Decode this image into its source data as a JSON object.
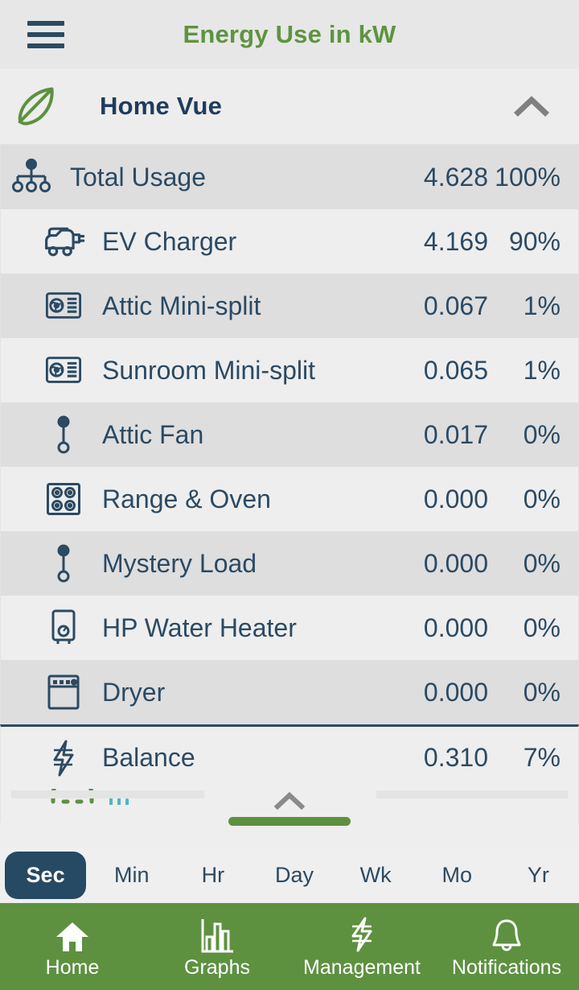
{
  "header": {
    "menu_icon": "hamburger-menu-icon",
    "title": "Energy Use in kW",
    "title_color": "#5e9440"
  },
  "device": {
    "leaf_icon": "leaf-icon",
    "name": "Home Vue",
    "collapse_icon": "chevron-up-icon"
  },
  "list": {
    "rows": [
      {
        "icon": "network-tree-icon",
        "label": "Total Usage",
        "value": "4.628",
        "percent": "100%"
      },
      {
        "icon": "ev-charger-icon",
        "label": "EV Charger",
        "value": "4.169",
        "percent": "90%"
      },
      {
        "icon": "mini-split-icon",
        "label": "Attic Mini-split",
        "value": "0.067",
        "percent": "1%"
      },
      {
        "icon": "mini-split-icon",
        "label": "Sunroom Mini-split",
        "value": "0.065",
        "percent": "1%"
      },
      {
        "icon": "circuit-pin-icon",
        "label": "Attic Fan",
        "value": "0.017",
        "percent": "0%"
      },
      {
        "icon": "range-oven-icon",
        "label": "Range & Oven",
        "value": "0.000",
        "percent": "0%"
      },
      {
        "icon": "circuit-pin-icon",
        "label": "Mystery Load",
        "value": "0.000",
        "percent": "0%"
      },
      {
        "icon": "water-heater-icon",
        "label": "HP Water Heater",
        "value": "0.000",
        "percent": "0%"
      },
      {
        "icon": "dryer-icon",
        "label": "Dryer",
        "value": "0.000",
        "percent": "0%"
      }
    ],
    "balance": {
      "icon": "lightning-bolt-icon",
      "label": "Balance",
      "value": "0.310",
      "percent": "7%"
    }
  },
  "partial_row": {
    "icon": "green-vehicle-icon",
    "secondary_icon": "bar-chart-icon",
    "label": "",
    "value": ""
  },
  "scroll": {
    "pull_icon": "chevron-up-icon",
    "drag_handle": "drag-handle",
    "handle_color": "#5d9140"
  },
  "periods": {
    "selected": "Sec",
    "options": [
      "Sec",
      "Min",
      "Hr",
      "Day",
      "Wk",
      "Mo",
      "Yr"
    ],
    "active_bg": "#264a63"
  },
  "nav": {
    "background": "#5d9140",
    "items": [
      {
        "icon": "home-icon",
        "label": "Home"
      },
      {
        "icon": "bar-chart-icon",
        "label": "Graphs"
      },
      {
        "icon": "lightning-bolt-icon",
        "label": "Management"
      },
      {
        "icon": "bell-icon",
        "label": "Notifications"
      }
    ]
  },
  "colors": {
    "ink": "#2b4a63",
    "green": "#5d9140",
    "row_odd": "#dedede",
    "row_even": "#eeeeee"
  }
}
